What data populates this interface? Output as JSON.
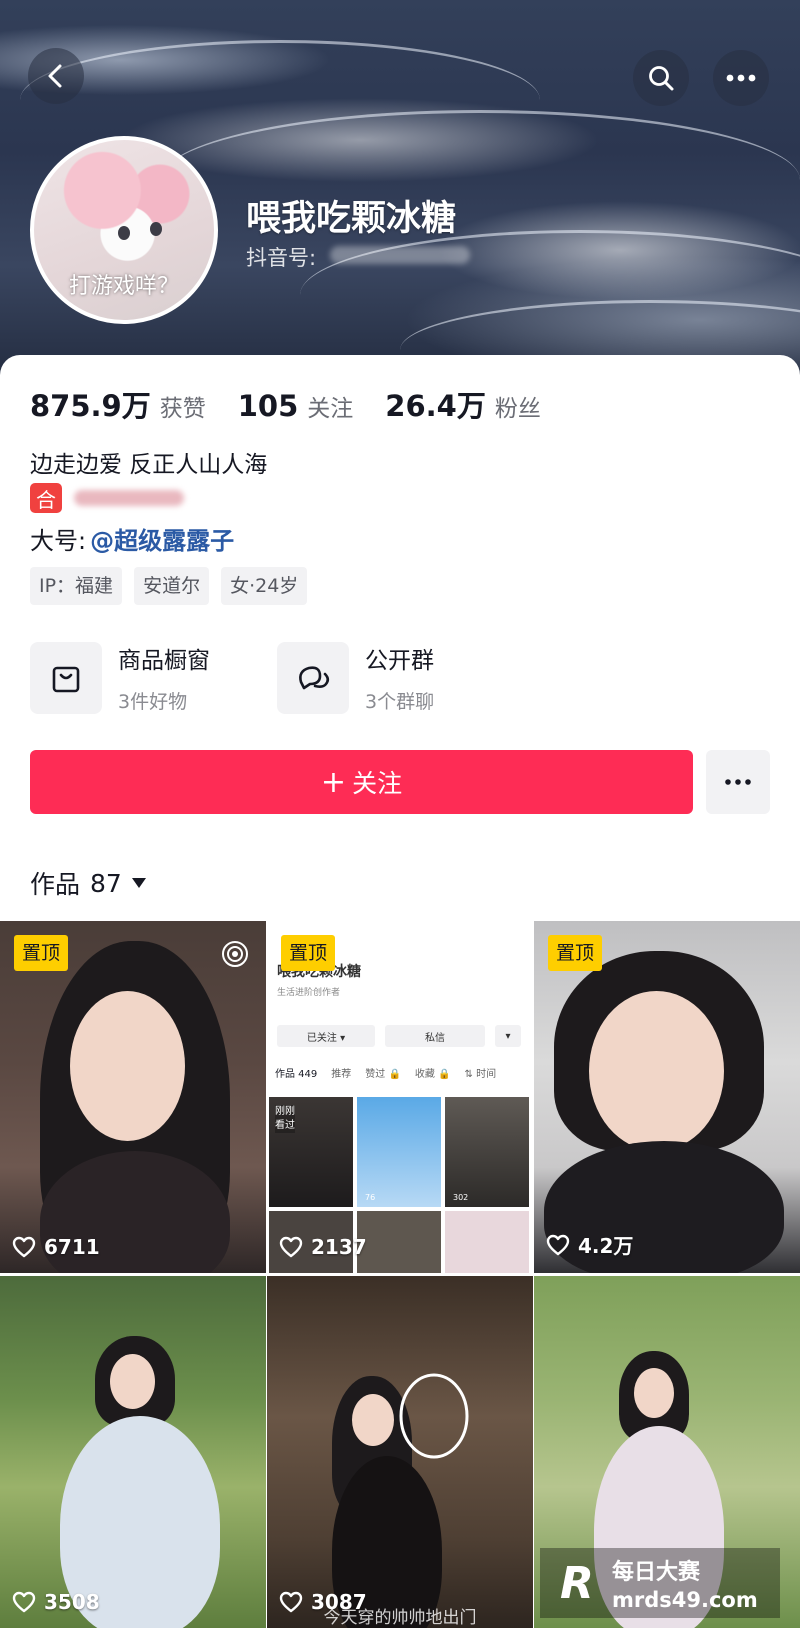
{
  "profile": {
    "nickname": "喂我吃颗冰糖",
    "douyin_id_label": "抖音号:",
    "avatar_caption": "打游戏咩？"
  },
  "stats": [
    {
      "value": "875.9万",
      "label": "获赞"
    },
    {
      "value": "105",
      "label": "关注"
    },
    {
      "value": "26.4万",
      "label": "粉丝"
    }
  ],
  "bio": "边走边爱 反正人山人海",
  "collab_badge": "合",
  "main_account": {
    "label": "大号:",
    "link": "@超级露露子"
  },
  "tags": [
    "IP：福建",
    "安道尔",
    "女·24岁"
  ],
  "entries": {
    "shop": {
      "title": "商品橱窗",
      "subtitle": "3件好物",
      "icon": "shopping-bag-icon"
    },
    "group": {
      "title": "公开群",
      "subtitle": "3个群聊",
      "icon": "chat-bubbles-icon"
    }
  },
  "follow_button": {
    "plus": "+",
    "label": "关注"
  },
  "works": {
    "label": "作品",
    "count": "87"
  },
  "videos": [
    {
      "pinned": true,
      "pin_label": "置顶",
      "likes": "6711"
    },
    {
      "pinned": true,
      "pin_label": "置顶",
      "likes": "2137"
    },
    {
      "pinned": true,
      "pin_label": "置顶",
      "likes": "4.2万"
    },
    {
      "pinned": false,
      "likes": "3508"
    },
    {
      "pinned": false,
      "likes": "3087",
      "caption": "今天穿的帅帅地出门"
    },
    {
      "pinned": false,
      "likes": ""
    }
  ],
  "mini_screenshot": {
    "name": "喂我吃颗冰糖",
    "subtitle": "生活进阶创作者",
    "followed_btn": "已关注 ▾",
    "message_btn": "私信",
    "dropdown_btn": "▾",
    "tabs": [
      "作品 449",
      "推荐",
      "赞过 🔒",
      "收藏 🔒",
      "⇅ 时间"
    ],
    "seen_label": "刚刚\n看过",
    "tile_values": [
      "76",
      "302"
    ]
  },
  "watermark": {
    "logo": "R",
    "title": "每日大赛",
    "site": "mrds49.com"
  },
  "colors": {
    "accent": "#fe2c55",
    "pin": "#fece00",
    "link": "#2b5aa5"
  }
}
